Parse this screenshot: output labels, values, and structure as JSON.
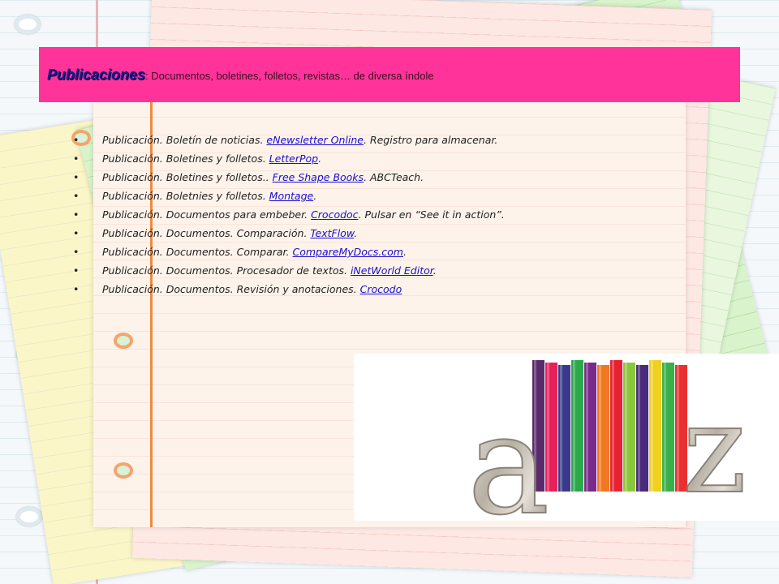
{
  "header": {
    "title_main": "Publicaciones",
    "title_rest": ": Documentos, boletines, folletos, revistas… de diversa índole"
  },
  "items": [
    {
      "pre": "Publicación. Boletín de noticias. ",
      "link": "eNewsletter Online",
      "post": ". Registro para almacenar."
    },
    {
      "pre": "Publicación. Boletines y folletos. ",
      "link": "LetterPop",
      "post": "."
    },
    {
      "pre": "Publicación. Boletines y folletos.. ",
      "link": "Free Shape Books",
      "post": ". ABCTeach."
    },
    {
      "pre": "Publicación. Boletnies y folletos. ",
      "link": "Montage",
      "post": "."
    },
    {
      "pre": "Publicación. Documentos para embeber. ",
      "link": "Crocodoc",
      "post": ". Pulsar en “See it in action”."
    },
    {
      "pre": "Publicación. Documentos. Comparación. ",
      "link": "TextFlow",
      "post": "."
    },
    {
      "pre": "Publicación. Documentos. Comparar. ",
      "link": "CompareMyDocs.com",
      "post": "."
    },
    {
      "pre": "Publicación. Documentos. Procesador de textos. ",
      "link": "iNetWorld Editor",
      "post": "."
    },
    {
      "pre": "Publicación. Documentos. Revisión y anotaciones. ",
      "link": "Crocodo",
      "post": ""
    }
  ],
  "image": {
    "letters": [
      "a",
      "z"
    ],
    "book_colors": [
      "#5a2a6a",
      "#e8205a",
      "#3a3a8a",
      "#2aa84a",
      "#7a2a8a",
      "#f07820",
      "#e82030",
      "#8ac83a",
      "#4a2a7a",
      "#f0d020",
      "#3ab04a",
      "#e83030"
    ]
  },
  "colors": {
    "title_bar": "#ff3399",
    "title_text": "#1a1a8a",
    "link": "#1a0dcc"
  }
}
